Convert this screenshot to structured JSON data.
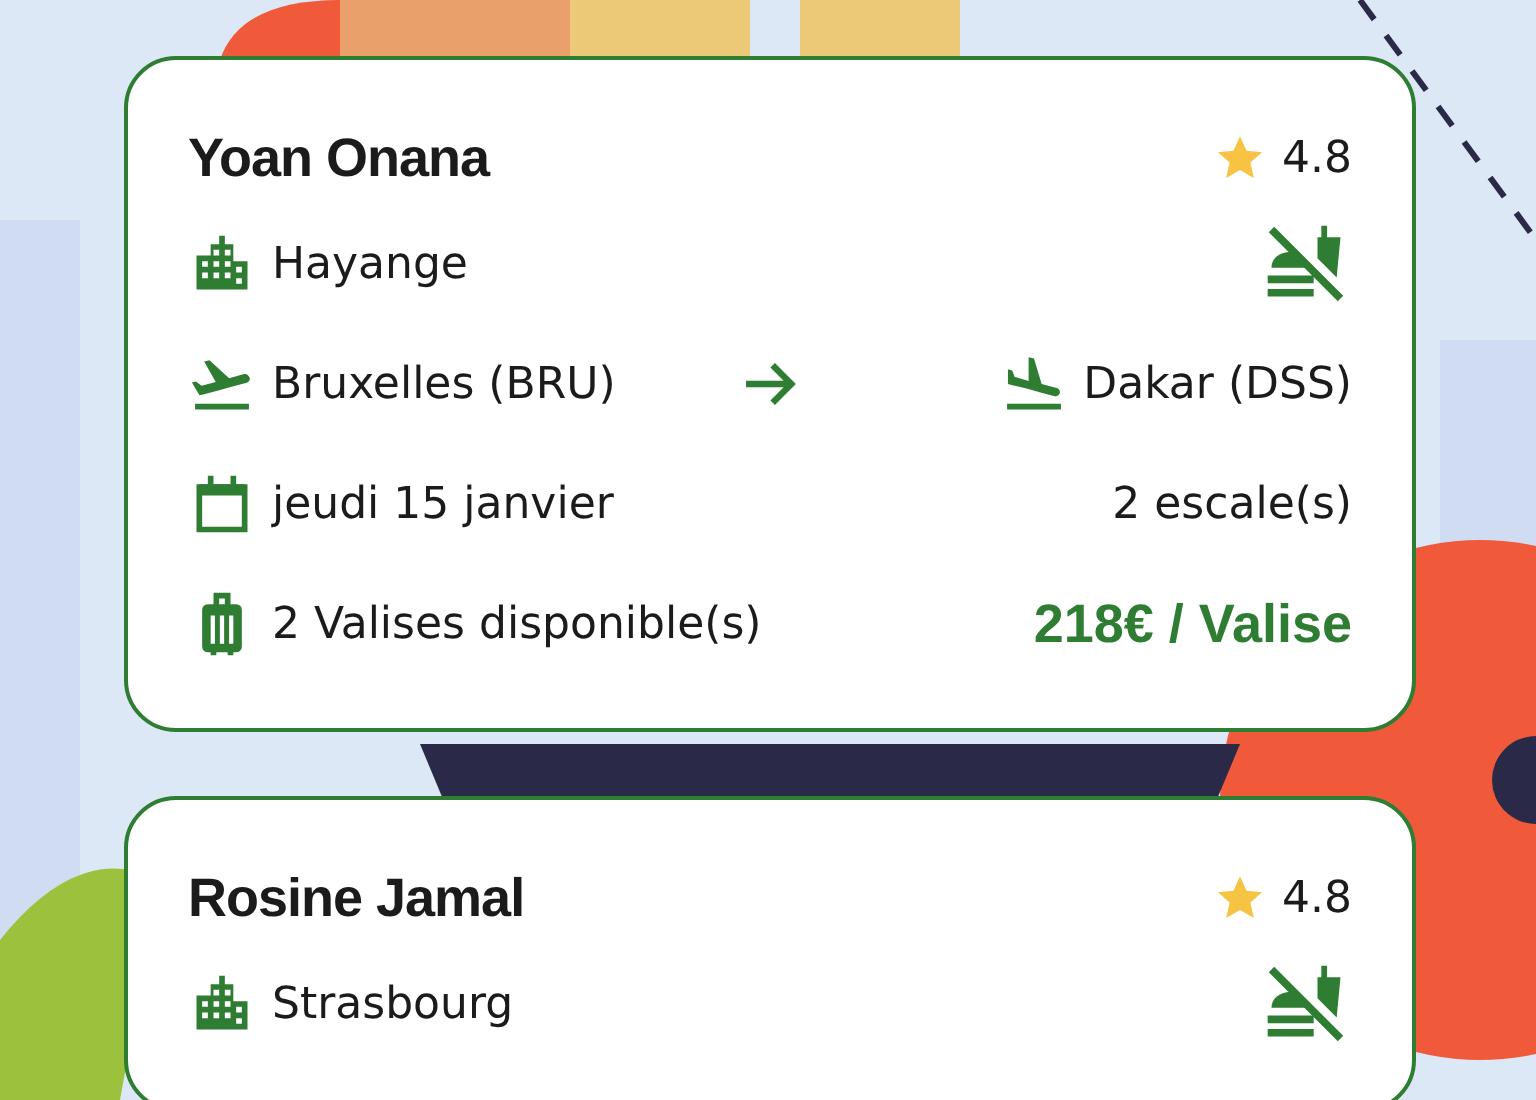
{
  "offers": [
    {
      "name": "Yoan Onana",
      "rating": "4.8",
      "city": "Hayange",
      "from": "Bruxelles (BRU)",
      "to": "Dakar (DSS)",
      "date": "jeudi 15 janvier",
      "stops": "2 escale(s)",
      "bags": "2 Valises disponible(s)",
      "price": "218€ / Valise"
    },
    {
      "name": "Rosine Jamal",
      "rating": "4.8",
      "city": "Strasbourg"
    }
  ]
}
